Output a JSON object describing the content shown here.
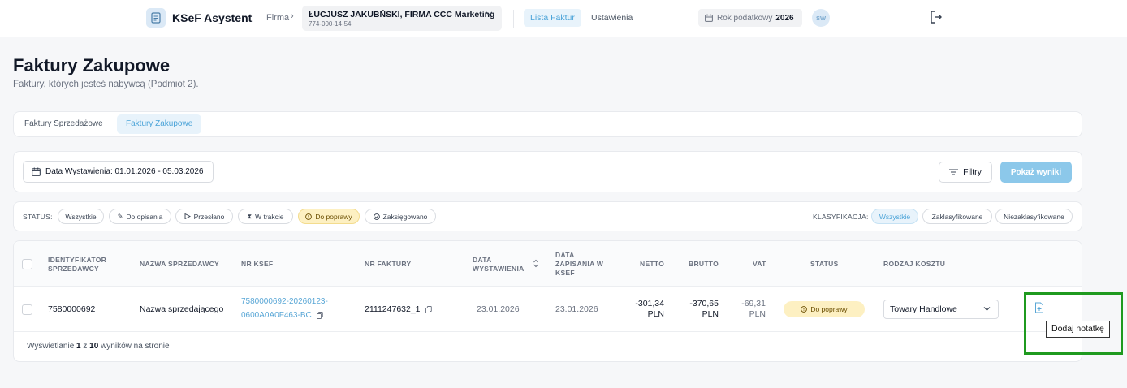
{
  "topbar": {
    "app_title": "KSeF Asystent",
    "firma_label": "Firma",
    "company_name": "ŁUCJUSZ JAKUBŃSKI, FIRMA CCC Marketing",
    "company_nip": "774-000-14-54",
    "nav_active": "Lista Faktur",
    "nav_settings": "Ustawienia",
    "year_label": "Rok podatkowy",
    "year_value": "2026",
    "avatar_initials": "SW"
  },
  "page": {
    "title": "Faktury Zakupowe",
    "subtitle": "Faktury, których jesteś nabywcą (Podmiot 2)."
  },
  "tabs": [
    {
      "label": "Faktury Sprzedażowe",
      "active": false
    },
    {
      "label": "Faktury Zakupowe",
      "active": true
    }
  ],
  "filters": {
    "date_label": "Data Wystawienia: 01.01.2026 - 05.03.2026",
    "filtry_label": "Filtry",
    "show_results_label": "Pokaż wyniki"
  },
  "status_filter": {
    "label": "STATUS:",
    "chips": [
      "Wszystkie",
      "Do opisania",
      "Przesłano",
      "W trakcie",
      "Do poprawy",
      "Zaksięgowano"
    ],
    "selected": "Do poprawy"
  },
  "klasyfikacja_filter": {
    "label": "KLASYFIKACJA:",
    "chips": [
      "Wszystkie",
      "Zaklasyfikowane",
      "Niezaklasyfikowane"
    ],
    "selected": "Wszystkie"
  },
  "table": {
    "headers": {
      "seller_id_1": "IDENTYFIKATOR",
      "seller_id_2": "SPRZEDAWCY",
      "seller_name": "NAZWA SPRZEDAWCY",
      "ksef_nr": "NR KSEF",
      "invoice_nr": "NR FAKTURY",
      "issue_date_1": "DATA",
      "issue_date_2": "WYSTAWIENIA",
      "saved_date_1": "DATA",
      "saved_date_2": "ZAPISANIA W",
      "saved_date_3": "KSEF",
      "netto": "NETTO",
      "brutto": "BRUTTO",
      "vat": "VAT",
      "status": "STATUS",
      "cost_type": "RODZAJ KOSZTU"
    },
    "rows": [
      {
        "seller_id": "7580000692",
        "seller_name": "Nazwa sprzedającego",
        "ksef_line1": "7580000692-20260123-",
        "ksef_line2": "0600A0A0F463-BC",
        "invoice_nr": "2111247632_1",
        "issue_date": "23.01.2026",
        "saved_date": "23.01.2026",
        "netto_value": "-301,34",
        "netto_currency": "PLN",
        "brutto_value": "-370,65",
        "brutto_currency": "PLN",
        "vat_value": "-69,31",
        "vat_currency": "PLN",
        "status": "Do poprawy",
        "cost_type": "Towary Handlowe"
      }
    ],
    "footer": {
      "prefix": "Wyświetlanie",
      "shown": "1",
      "middle": "z",
      "per_page": "10",
      "suffix": "wyników na stronie"
    }
  },
  "tooltip": "Dodaj notatkę",
  "colors": {
    "accent": "#4aa3d8",
    "warning_bg": "#fdf0c2",
    "highlight": "#1f9a1f"
  }
}
